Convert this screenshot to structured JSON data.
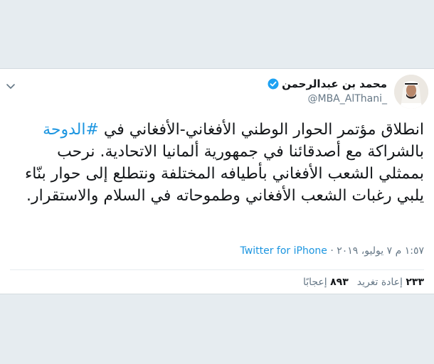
{
  "tweet": {
    "display_name": "محمد بن عبدالرحمن",
    "handle": "@MBA_AlThani_",
    "verified_icon": "verified-badge-icon",
    "menu_icon": "chevron-down-icon",
    "text_line1_prefix": "انطلاق مؤتمر الحوار الوطني الأفغاني-الأفغاني في ",
    "hashtag": "#الدوحة",
    "text_rest": "بالشراكة مع أصدقائنا في جمهورية ألمانيا الاتحادية. نرحب بممثلي الشعب الأفغاني بأطيافه المختلفة ونتطلع إلى حوار بنّاء يلبي رغبات الشعب الأفغاني وطموحاته في السلام والاستقرار.",
    "time": "١:٥٧ م",
    "date": "٧ يوليو، ٢٠١٩",
    "separator": "·",
    "source": "Twitter for iPhone",
    "retweets_count": "٢٣٣",
    "retweets_label": "إعادة تغريد",
    "likes_count": "٨٩٣",
    "likes_label": "إعجابًا"
  },
  "colors": {
    "link": "#1b95e0",
    "verified": "#1da1f2",
    "text": "#14171a",
    "muted": "#657786",
    "background": "#e6ecf0"
  }
}
